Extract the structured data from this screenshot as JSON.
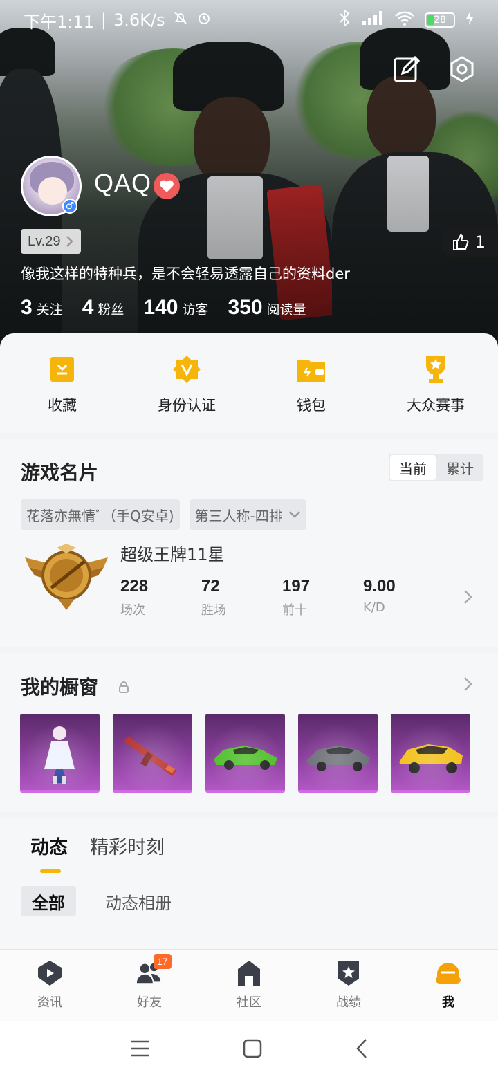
{
  "status_bar": {
    "time": "下午1:11",
    "speed": "3.6K/s",
    "battery": "28"
  },
  "profile": {
    "username": "QAQ",
    "level": "Lv.29",
    "bio": "像我这样的特种兵，是不会轻易透露自己的资料der",
    "likes": "1",
    "stats": [
      {
        "num": "3",
        "label": "关注"
      },
      {
        "num": "4",
        "label": "粉丝"
      },
      {
        "num": "140",
        "label": "访客"
      },
      {
        "num": "350",
        "label": "阅读量"
      }
    ]
  },
  "shortcuts": [
    {
      "label": "收藏",
      "icon": "bookmark-icon"
    },
    {
      "label": "身份认证",
      "icon": "verify-badge-icon"
    },
    {
      "label": "钱包",
      "icon": "wallet-icon"
    },
    {
      "label": "大众赛事",
      "icon": "trophy-icon"
    }
  ],
  "game_card": {
    "title": "游戏名片",
    "toggle": {
      "current": "当前",
      "cumulative": "累计",
      "selected": "当前"
    },
    "account": "花落亦無情ﾞ（手Q安卓)",
    "mode": "第三人称-四排",
    "rank": "超级王牌11星",
    "metrics": [
      {
        "value": "228",
        "label": "场次"
      },
      {
        "value": "72",
        "label": "胜场"
      },
      {
        "value": "197",
        "label": "前十"
      },
      {
        "value": "9.00",
        "label": "K/D"
      }
    ]
  },
  "showcase": {
    "title": "我的橱窗",
    "items": [
      "outfit-item",
      "rifle-skin-item",
      "green-car-item",
      "gray-car-item",
      "yellow-suv-item"
    ]
  },
  "feed": {
    "tabs": [
      "动态",
      "精彩时刻"
    ],
    "active_tab": "动态",
    "subtabs": [
      "全部",
      "动态相册"
    ],
    "active_subtab": "全部"
  },
  "bottom_nav": {
    "items": [
      {
        "label": "资讯",
        "icon": "news-icon"
      },
      {
        "label": "好友",
        "icon": "friends-icon",
        "badge": "17"
      },
      {
        "label": "社区",
        "icon": "community-icon"
      },
      {
        "label": "战绩",
        "icon": "record-icon"
      },
      {
        "label": "我",
        "icon": "me-helmet-icon"
      }
    ],
    "active": "我"
  },
  "colors": {
    "accent": "#f5b50a",
    "badge": "#ff6a2b",
    "showcase_purple": "#8a3f9c"
  }
}
